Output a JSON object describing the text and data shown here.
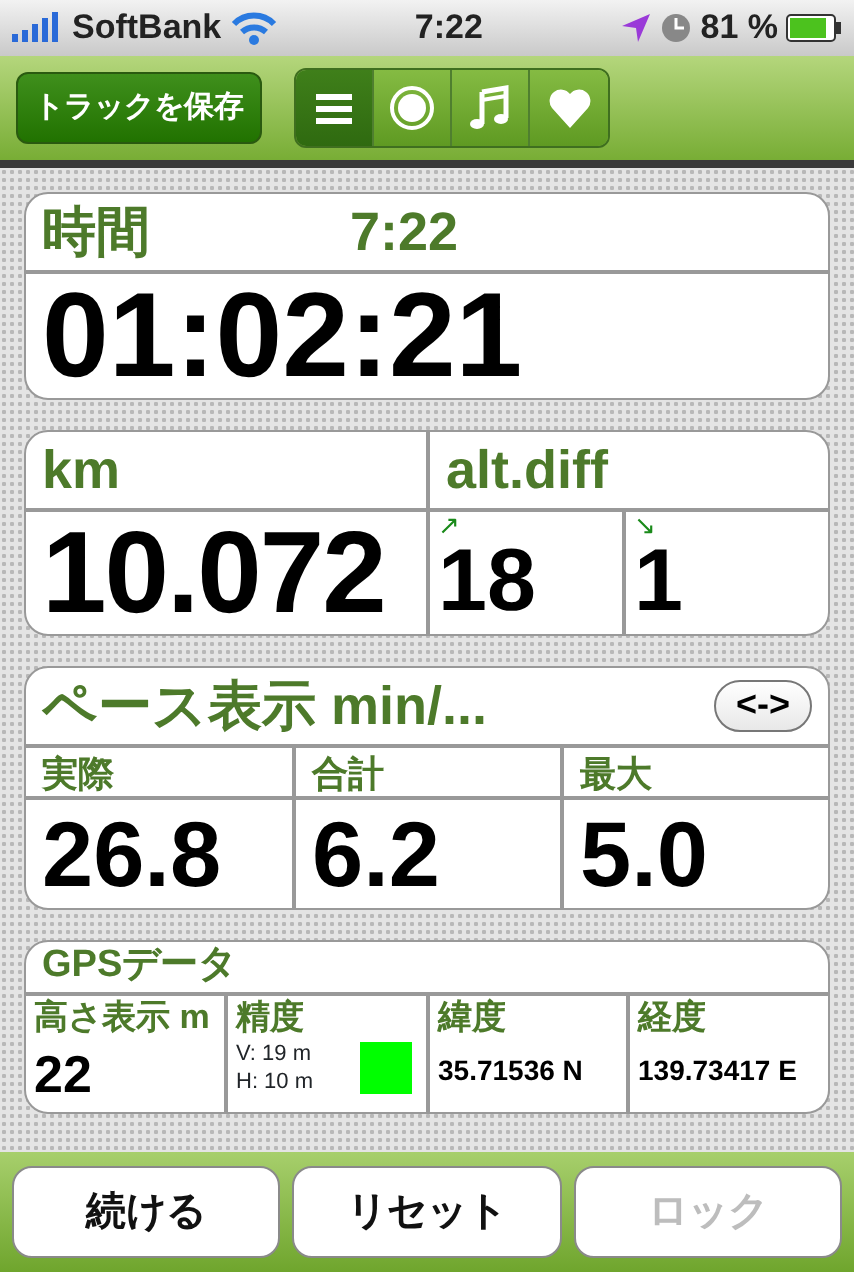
{
  "status_bar": {
    "carrier": "SoftBank",
    "time": "7:22",
    "battery": "81 %"
  },
  "toolbar": {
    "save_button": "トラックを保存",
    "segments": [
      {
        "kind": "list",
        "selected": true
      },
      {
        "kind": "record",
        "selected": false
      },
      {
        "kind": "music",
        "selected": false
      },
      {
        "kind": "heart",
        "selected": false
      }
    ]
  },
  "time_card": {
    "label": "時間",
    "clock": "7:22",
    "value": "01:02:21"
  },
  "distance_card": {
    "label": "km",
    "value": "10.072",
    "altitude": {
      "label": "alt.diff",
      "up_arrow": "↗",
      "up": "18",
      "down_arrow": "↘",
      "down": "1"
    }
  },
  "pace_card": {
    "title": "ペース表示 min/...",
    "toggle": "<->",
    "cells": [
      {
        "label": "実際",
        "value": "26.8"
      },
      {
        "label": "合計",
        "value": "6.2"
      },
      {
        "label": "最大",
        "value": "5.0"
      }
    ]
  },
  "gps_card": {
    "title": "GPSデータ",
    "altitude": {
      "label": "高さ表示 m",
      "value": "22"
    },
    "accuracy": {
      "label": "精度",
      "vertical": "V: 19 m",
      "horizontal": "H: 10 m",
      "color": "#00ff00"
    },
    "latitude": {
      "label": "緯度",
      "value": "35.71536 N"
    },
    "longitude": {
      "label": "経度",
      "value": "139.73417 E"
    }
  },
  "buttons": [
    {
      "label": "続ける",
      "disabled": false
    },
    {
      "label": "リセット",
      "disabled": false
    },
    {
      "label": "ロック",
      "disabled": true
    }
  ]
}
